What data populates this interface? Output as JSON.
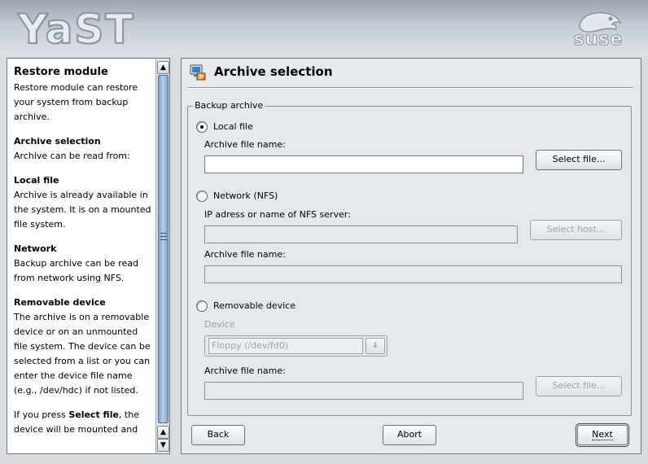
{
  "banner": {
    "app_logo_text": "YaST",
    "vendor_logo_text": "suse"
  },
  "help": {
    "title": "Restore module",
    "intro": "Restore module can restore your system from backup archive.",
    "sections": [
      {
        "heading": "Archive selection",
        "text": "Archive can be read from:"
      },
      {
        "heading": "Local file",
        "text": "Archive is already available in the system. It is on a mounted file system."
      },
      {
        "heading": "Network",
        "text": "Backup archive can be read from network using NFS."
      },
      {
        "heading": "Removable device",
        "text": "The archive is on a removable device or on an unmounted file system. The device can be selected from a list or you can enter the device file name (e.g., /dev/hdc) if not listed."
      }
    ],
    "footer_pre": "If you press ",
    "footer_bold": "Select file",
    "footer_post": ", the device will be mounted and"
  },
  "main": {
    "title": "Archive selection",
    "group_label": "Backup archive",
    "local": {
      "label": "Local file",
      "selected": true,
      "file_label": "Archive file name:",
      "file_value": "",
      "select_button": "Select file..."
    },
    "network": {
      "label": "Network (NFS)",
      "selected": false,
      "server_label": "IP adress or name of NFS server:",
      "server_value": "",
      "select_host_button": "Select host...",
      "file_label": "Archive file name:",
      "file_value": ""
    },
    "removable": {
      "label": "Removable device",
      "selected": false,
      "device_label": "Device",
      "device_value": "Floppy (/dev/fd0)",
      "file_label": "Archive file name:",
      "file_value": "",
      "select_button": "Select file..."
    }
  },
  "nav": {
    "back": "Back",
    "abort": "Abort",
    "next": "Next"
  }
}
